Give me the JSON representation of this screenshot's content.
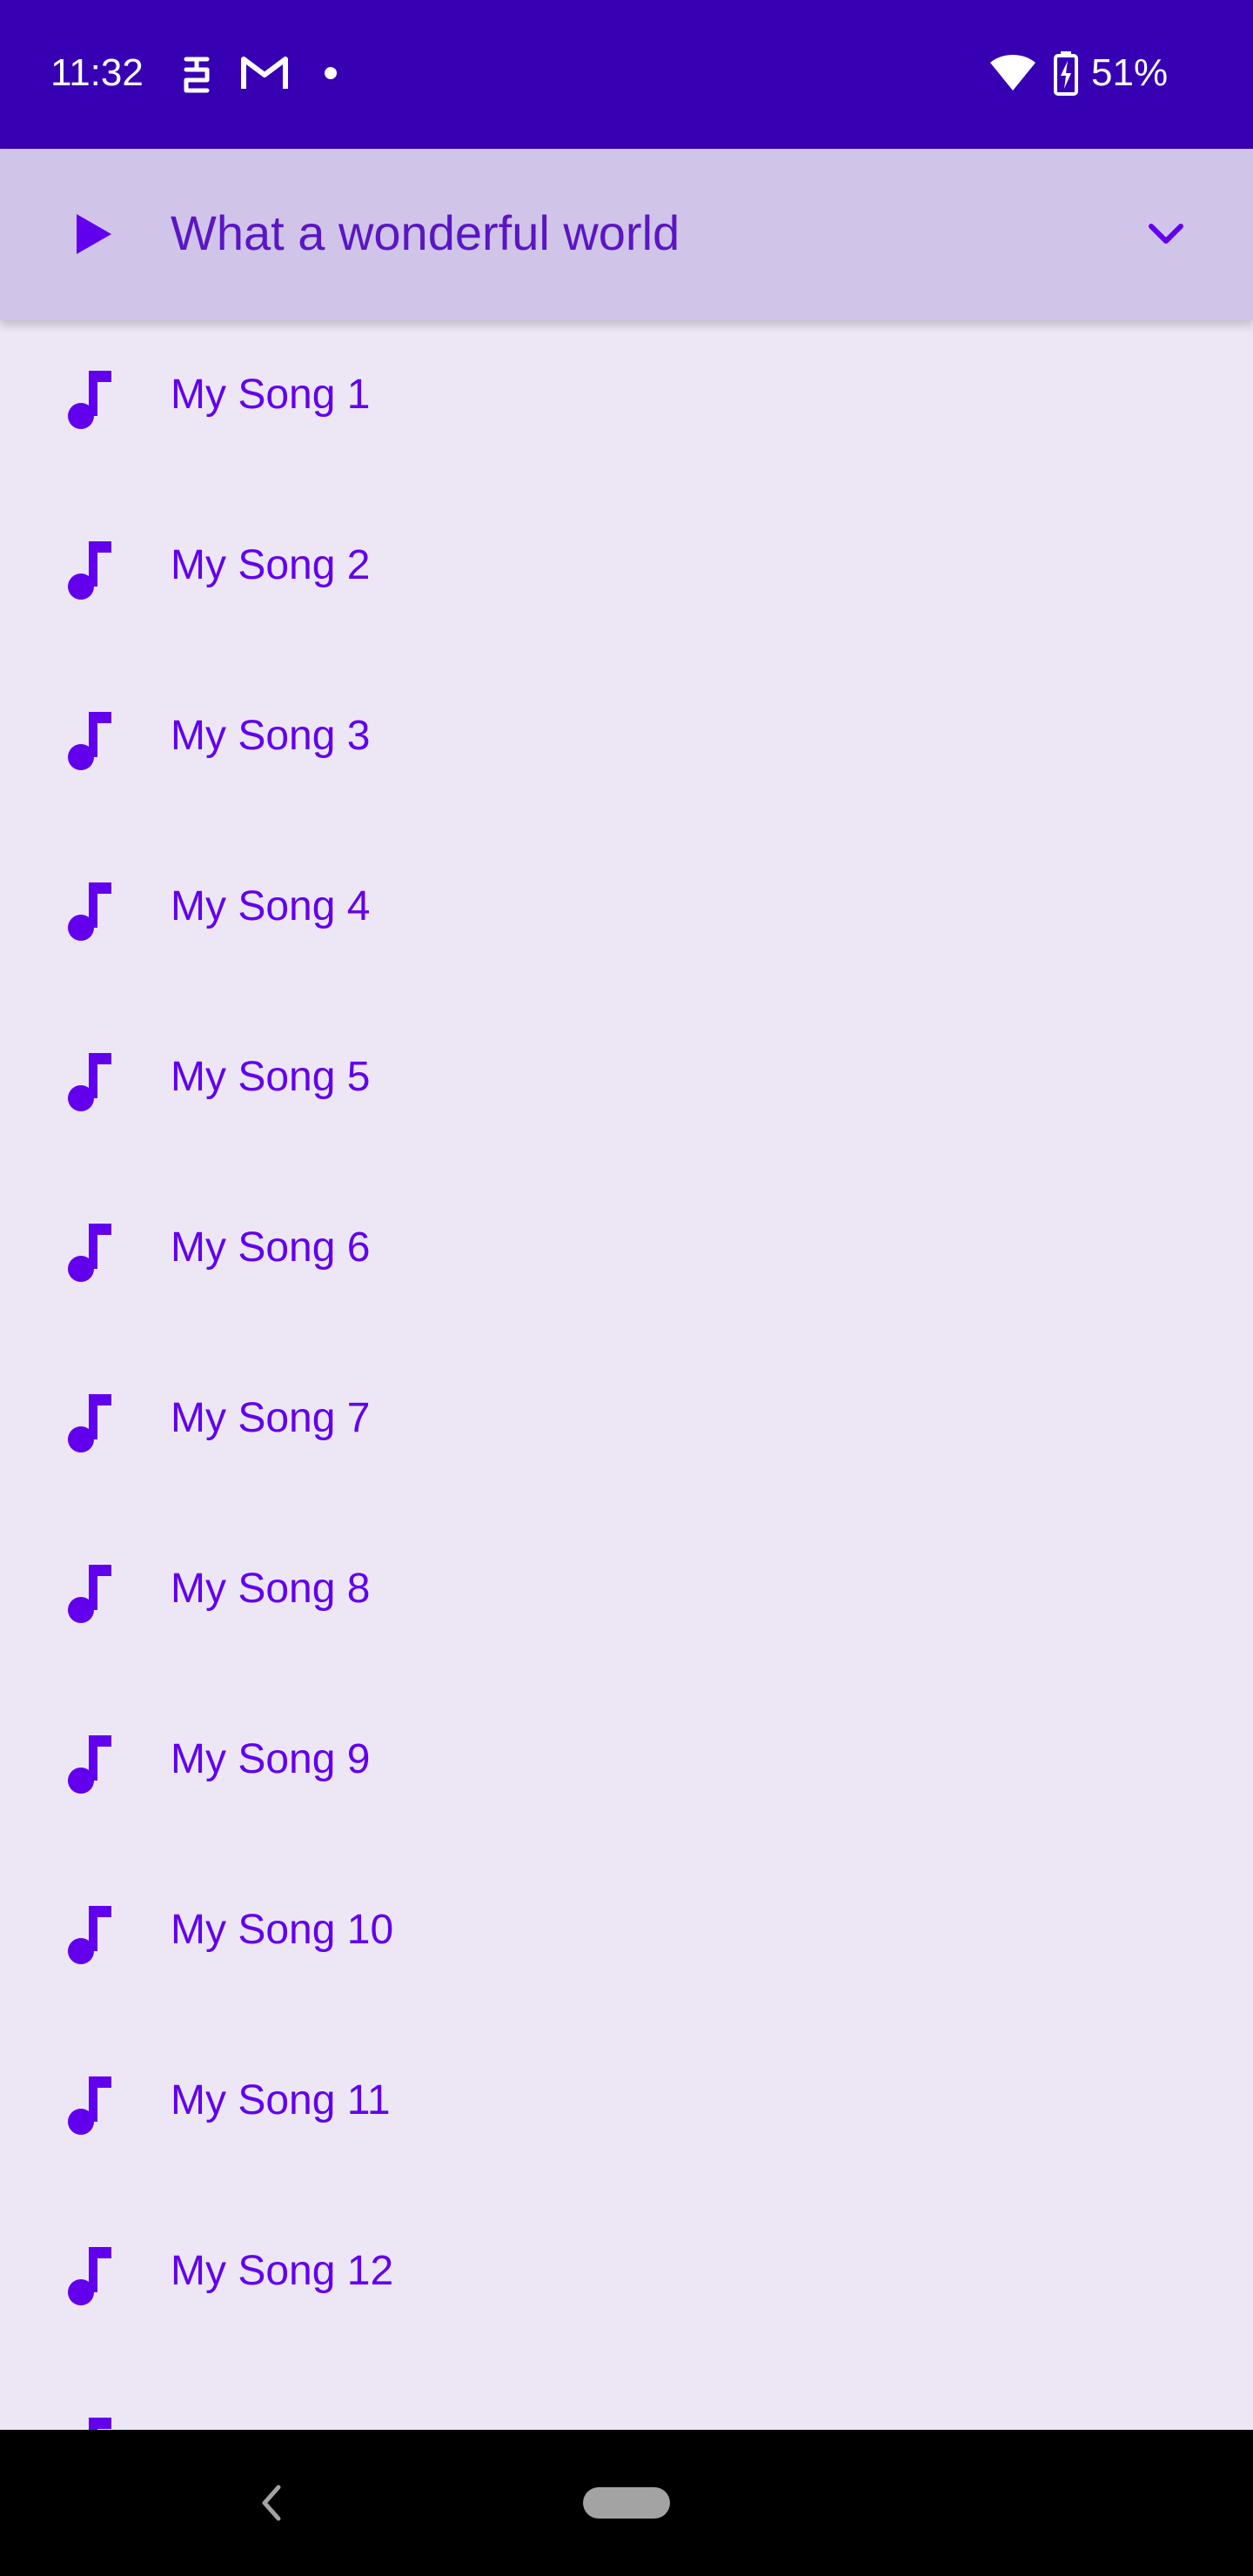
{
  "status_bar": {
    "time": "11:32",
    "battery": "51%",
    "icons": [
      "vpn-key-icon",
      "gmail-icon",
      "notification-dot-icon",
      "wifi-icon",
      "battery-charging-icon"
    ],
    "background_color": "#3700b3"
  },
  "now_playing": {
    "title": "What a wonderful world",
    "play_icon": "play-icon",
    "collapse_icon": "chevron-down-icon",
    "background_color": "#d1c4e9",
    "text_color": "#5a16c4"
  },
  "songs": [
    {
      "label": "My Song 1"
    },
    {
      "label": "My Song 2"
    },
    {
      "label": "My Song 3"
    },
    {
      "label": "My Song 4"
    },
    {
      "label": "My Song 5"
    },
    {
      "label": "My Song 6"
    },
    {
      "label": "My Song 7"
    },
    {
      "label": "My Song 8"
    },
    {
      "label": "My Song 9"
    },
    {
      "label": "My Song 10"
    },
    {
      "label": "My Song 11"
    },
    {
      "label": "My Song 12"
    },
    {
      "label": ""
    }
  ],
  "list_style": {
    "icon": "music-note-icon",
    "accent_color": "#6200ee",
    "background_color": "#ede7f5"
  },
  "nav_bar": {
    "icons": [
      "back-icon",
      "home-pill"
    ]
  }
}
